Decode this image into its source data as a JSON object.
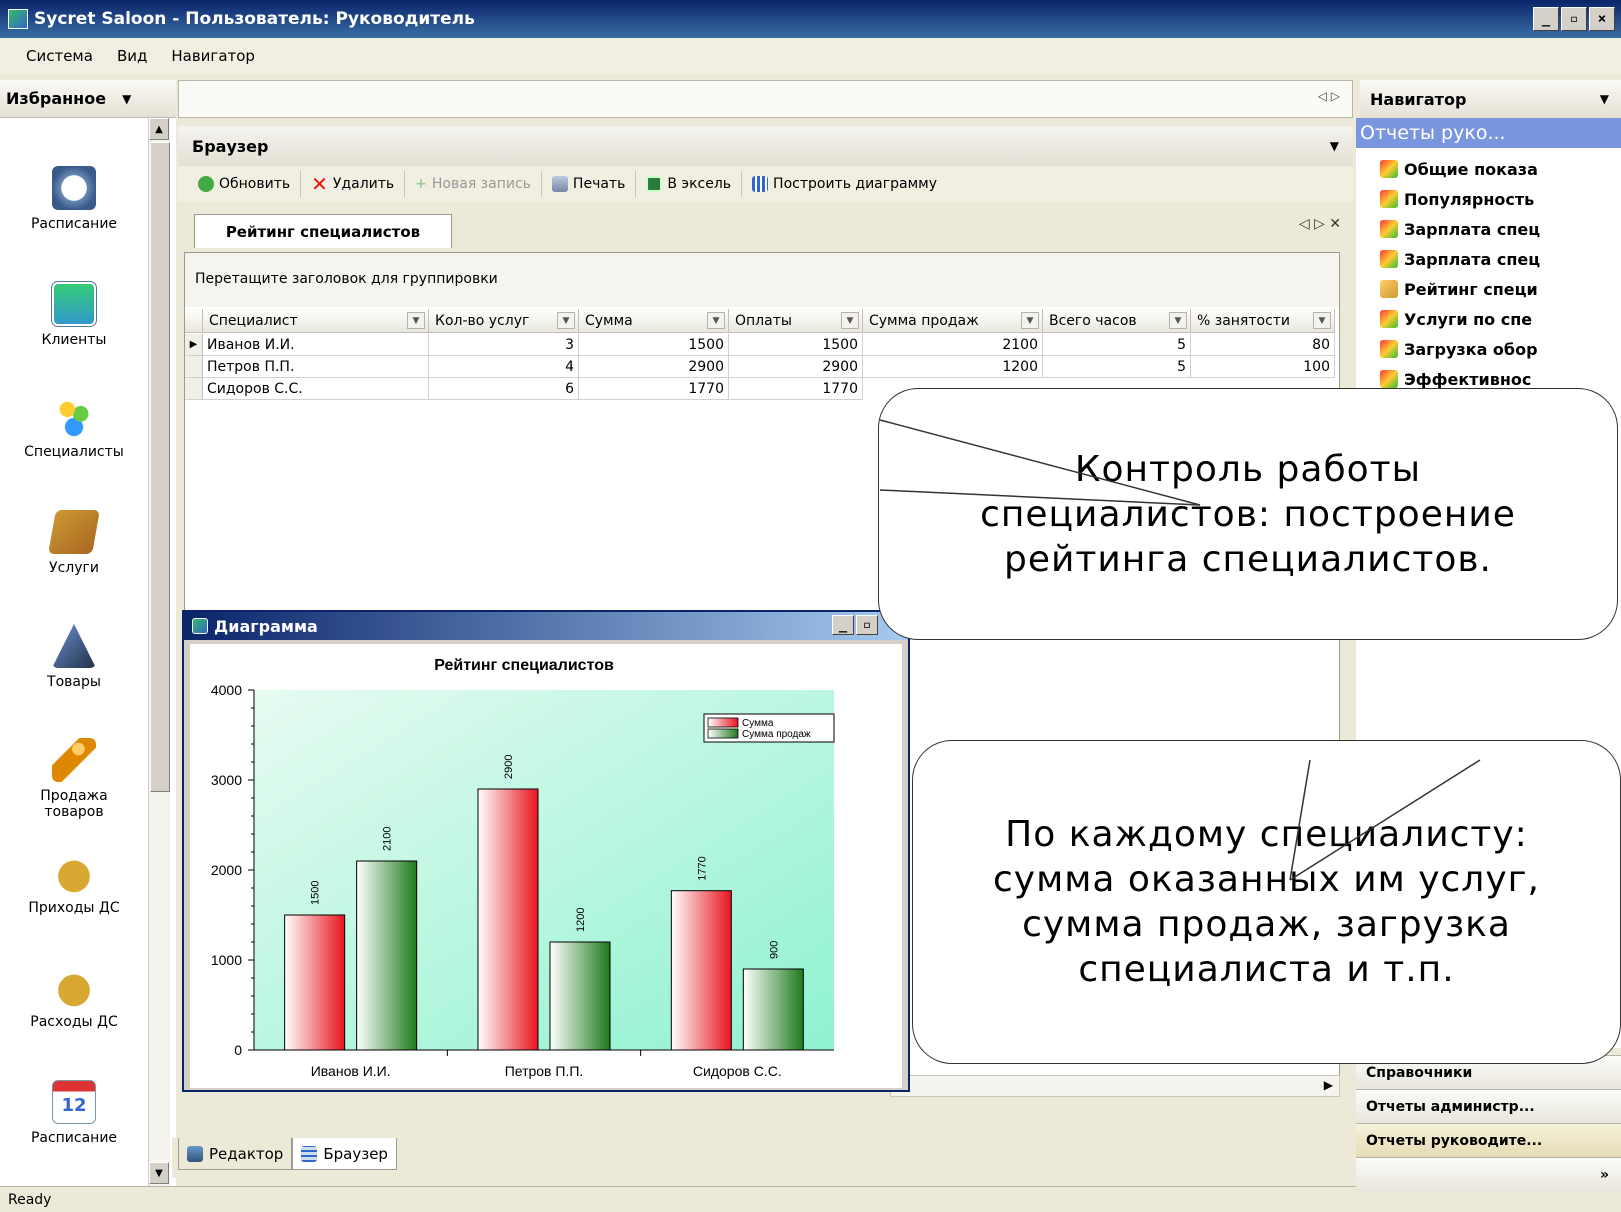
{
  "window": {
    "title": "Sycret Saloon - Пользователь: Руководитель"
  },
  "menu": [
    "Система",
    "Вид",
    "Навигатор"
  ],
  "favorites": {
    "header": "Избранное",
    "items": [
      "Расписание",
      "Клиенты",
      "Специалисты",
      "Услуги",
      "Товары",
      "Продажа товаров",
      "Приходы ДС",
      "Расходы ДС",
      "Расписание"
    ]
  },
  "browser": {
    "header": "Браузер",
    "toolbar": {
      "refresh": "Обновить",
      "delete": "Удалить",
      "new": "Новая запись",
      "print": "Печать",
      "excel": "В эксель",
      "chart": "Построить диаграмму"
    },
    "tab": "Рейтинг специалистов",
    "group_hint": "Перетащите заголовок для группировки",
    "columns": [
      "Специалист",
      "Кол-во услуг",
      "Сумма",
      "Оплаты",
      "Сумма продаж",
      "Всего часов",
      "% занятости"
    ],
    "rows": [
      [
        "Иванов И.И.",
        "3",
        "1500",
        "1500",
        "2100",
        "5",
        "80"
      ],
      [
        "Петров П.П.",
        "4",
        "2900",
        "2900",
        "1200",
        "5",
        "100"
      ],
      [
        "Сидоров С.С.",
        "6",
        "1770",
        "1770",
        "",
        "",
        ""
      ]
    ],
    "bottom_tabs": [
      "Редактор",
      "Браузер"
    ]
  },
  "navigator": {
    "header": "Навигатор",
    "title": "Отчеты руко...",
    "items": [
      "Общие показа",
      "Популярность",
      "Зарплата спец",
      "Зарплата спец",
      "Рейтинг специ",
      "Услуги по спе",
      "Загрузка обор",
      "Эффективнос"
    ],
    "sections": [
      "Справочники",
      "Отчеты администр...",
      "Отчеты руководите..."
    ]
  },
  "chart_window": {
    "title": "Диаграмма"
  },
  "chart_data": {
    "type": "bar",
    "title": "Рейтинг специалистов",
    "categories": [
      "Иванов И.И.",
      "Петров П.П.",
      "Сидоров С.С."
    ],
    "series": [
      {
        "name": "Сумма",
        "values": [
          1500,
          2900,
          1770
        ],
        "color": "#E8141E"
      },
      {
        "name": "Сумма продаж",
        "values": [
          2100,
          1200,
          900
        ],
        "color": "#1E7A1E"
      }
    ],
    "ylim": [
      0,
      4000
    ],
    "yticks": [
      0,
      1000,
      2000,
      3000,
      4000
    ],
    "legend": "top-right",
    "background": "#B9F5DC"
  },
  "callouts": {
    "top": "Контроль работы специалистов: построение рейтинга специалистов.",
    "bottom": "По каждому специалисту: сумма оказанных им услуг, сумма продаж, загрузка специалиста и т.п."
  },
  "status": "Ready",
  "icons": {
    "refresh": "refresh-icon",
    "delete": "delete-icon",
    "print": "print-icon",
    "excel": "excel-icon",
    "chart": "chart-icon"
  }
}
